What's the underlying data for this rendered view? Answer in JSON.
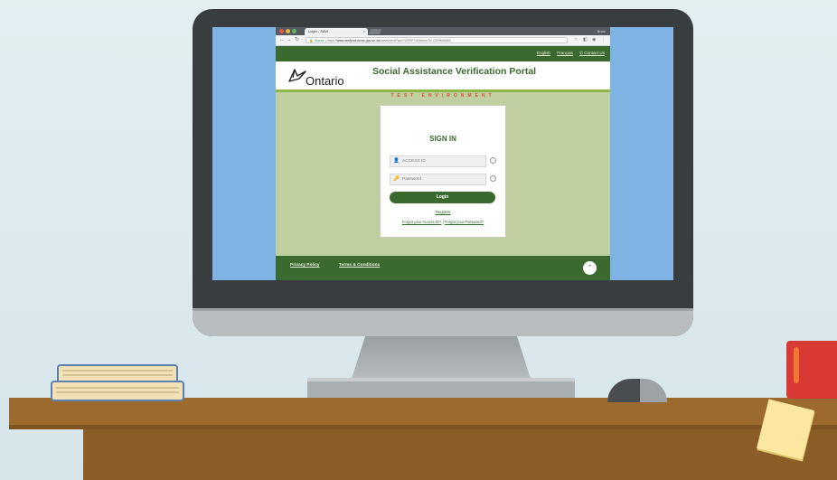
{
  "browser": {
    "tab_title": "Login - SAVI",
    "tab_close": "×",
    "user": "Brian",
    "secure_label": "Secure",
    "url_prefix": "https://",
    "url_domain": "www.verify.sa.mcss.gov.on.ca",
    "url_path": "/sams/veri/Flow=VERIFY&ReturnTo=OSNM#S8A",
    "back_icon": "back-arrow-icon",
    "forward_icon": "forward-arrow-icon",
    "reload_icon": "reload-icon"
  },
  "topnav": {
    "links": [
      "English",
      "Français",
      "✆ Contact Us"
    ]
  },
  "header": {
    "logo_text": "Ontario",
    "title": "Social Assistance Verification Portal",
    "environment_banner": "TEST ENVIRONMENT"
  },
  "signin": {
    "title": "SIGN IN",
    "access_id_placeholder": "ACCESS ID",
    "password_placeholder": "Password",
    "login_label": "Login",
    "register_label": "Register",
    "forgot_access_id": "Forgot your Access ID?",
    "separator": "|",
    "forgot_password": "Forgot your Password?"
  },
  "footer": {
    "privacy": "Privacy Policy",
    "terms": "Terms & Conditions",
    "to_top": "⌃"
  },
  "colors": {
    "brand_green": "#3b6a2e",
    "accent_green": "#8db548",
    "page_bg": "#bfcfa0",
    "test_banner": "#d7503b"
  }
}
